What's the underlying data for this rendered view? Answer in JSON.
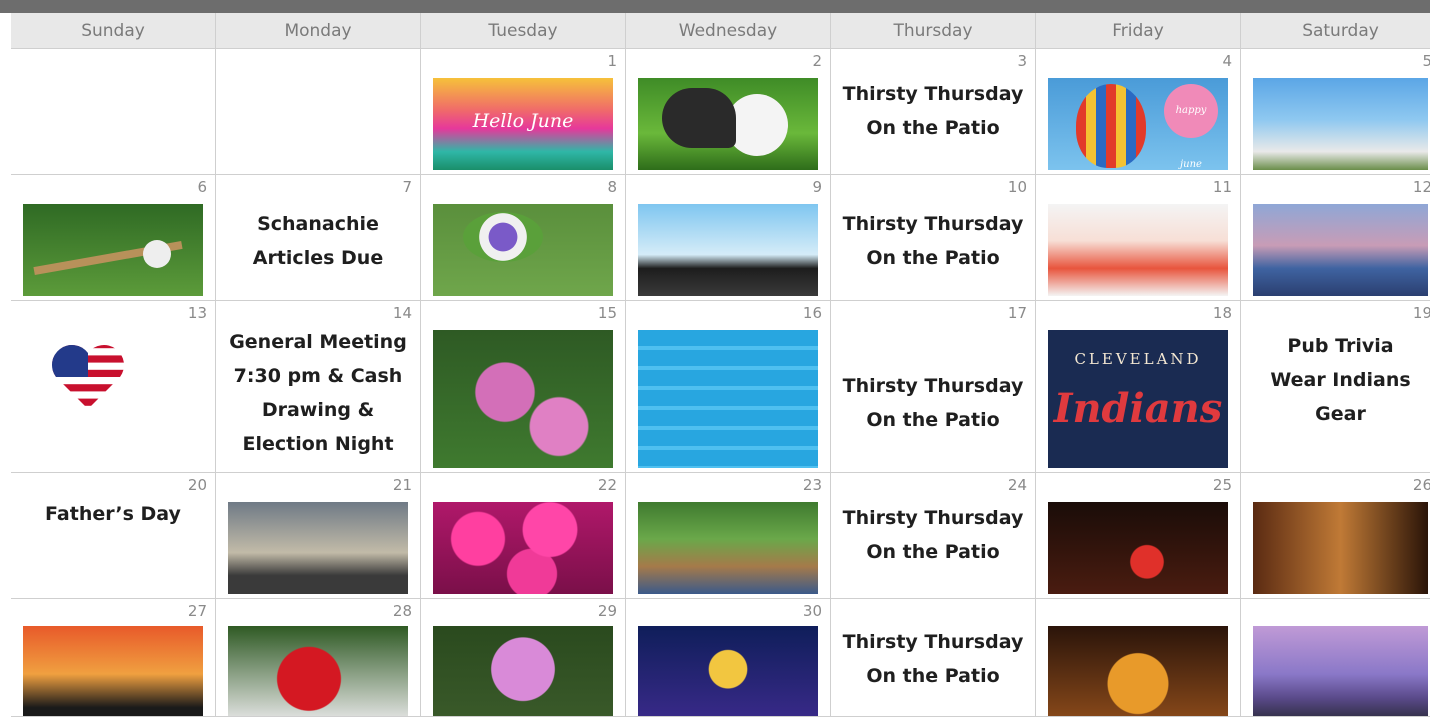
{
  "days": [
    "Sunday",
    "Monday",
    "Tuesday",
    "Wednesday",
    "Thursday",
    "Friday",
    "Saturday"
  ],
  "weeks": [
    [
      {
        "day": "",
        "event": "",
        "image": ""
      },
      {
        "day": "",
        "event": "",
        "image": ""
      },
      {
        "day": "1",
        "event": "",
        "image": "sunset-hello-june",
        "image_text": "Hello June"
      },
      {
        "day": "2",
        "event": "",
        "image": "golf-ball"
      },
      {
        "day": "3",
        "event": "Thirsty Thursday On the Patio",
        "event_lines": [
          "Thirsty Thursday",
          "On the Patio"
        ]
      },
      {
        "day": "4",
        "event": "",
        "image": "hot-air-balloon",
        "image_text": "happy june"
      },
      {
        "day": "5",
        "event": "",
        "image": "daisies"
      }
    ],
    [
      {
        "day": "6",
        "event": "",
        "image": "baseball-glove"
      },
      {
        "day": "7",
        "event": "Schanachie Articles Due",
        "event_lines": [
          "Schanachie",
          "Articles Due"
        ]
      },
      {
        "day": "8",
        "event": "",
        "image": "flower-bouquet"
      },
      {
        "day": "9",
        "event": "",
        "image": "cyclists"
      },
      {
        "day": "10",
        "event": "Thirsty Thursday On the Patio",
        "event_lines": [
          "Thirsty Thursday",
          "On the Patio"
        ]
      },
      {
        "day": "11",
        "event": "",
        "image": "cocktails"
      },
      {
        "day": "12",
        "event": "",
        "image": "lake-sunset"
      }
    ],
    [
      {
        "day": "13",
        "event": "",
        "image": "flag-heart"
      },
      {
        "day": "14",
        "event": "General Meeting 7:30 pm & Cash Drawing & Election Night",
        "event_lines": [
          "General Meeting",
          "7:30 pm & Cash",
          "Drawing &",
          "Election Night"
        ]
      },
      {
        "day": "15",
        "event": "",
        "image": "hydrangeas"
      },
      {
        "day": "16",
        "event": "",
        "image": "swimming-pool"
      },
      {
        "day": "17",
        "event": "Thirsty Thursday On the Patio",
        "event_lines": [
          "Thirsty Thursday",
          "On the Patio"
        ]
      },
      {
        "day": "18",
        "event": "",
        "image": "cleveland-indians",
        "image_text_top": "CLEVELAND",
        "image_text_logo": "Indians"
      },
      {
        "day": "19",
        "event": "Pub Trivia Wear Indians Gear",
        "event_lines": [
          "Pub Trivia",
          "Wear Indians",
          "Gear"
        ]
      }
    ],
    [
      {
        "day": "20",
        "event": "Father's Day",
        "event_lines": [
          "Father’s Day"
        ]
      },
      {
        "day": "21",
        "event": "",
        "image": "father-children-silhouette"
      },
      {
        "day": "22",
        "event": "",
        "image": "petunias"
      },
      {
        "day": "23",
        "event": "",
        "image": "picnic-basket"
      },
      {
        "day": "24",
        "event": "Thirsty Thursday On the Patio",
        "event_lines": [
          "Thirsty Thursday",
          "On the Patio"
        ]
      },
      {
        "day": "25",
        "event": "",
        "image": "cocktails-dark"
      },
      {
        "day": "26",
        "event": "",
        "image": "guinness-pint"
      }
    ],
    [
      {
        "day": "27",
        "event": "",
        "image": "sunset-silhouette"
      },
      {
        "day": "28",
        "event": "",
        "image": "red-rose"
      },
      {
        "day": "29",
        "event": "",
        "image": "rhododendron"
      },
      {
        "day": "30",
        "event": "",
        "image": "volleyball"
      },
      {
        "day": "",
        "event": "Thirsty Thursday On the Patio",
        "event_lines": [
          "Thirsty Thursday",
          "On the Patio"
        ]
      },
      {
        "day": "",
        "event": "",
        "image": "beer-glass"
      },
      {
        "day": "",
        "event": "",
        "image": "purple-lake"
      }
    ]
  ]
}
